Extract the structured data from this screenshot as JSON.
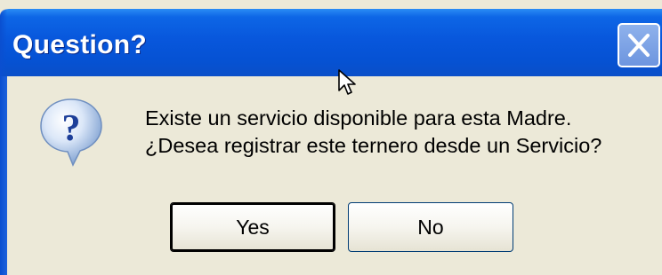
{
  "dialog": {
    "title": "Question?",
    "icon": "question-icon",
    "message_line1": "Existe un servicio disponible para esta Madre.",
    "message_line2": "¿Desea registrar este ternero desde un Servicio?",
    "yes_label": "Yes",
    "no_label": "No",
    "default_button": "yes",
    "close_icon": "close-icon"
  },
  "colors": {
    "titlebar": "#0857dc",
    "dialog_background": "#ece9d8",
    "button_border": "#003c74"
  }
}
